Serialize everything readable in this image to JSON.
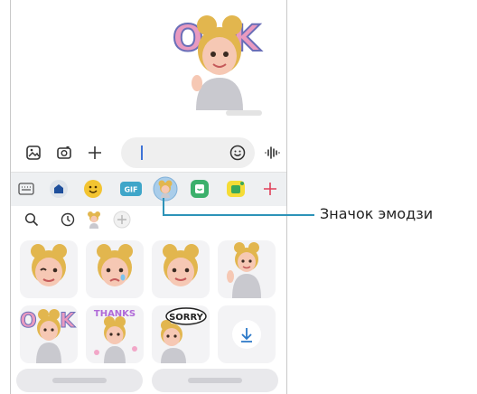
{
  "input_bar": {
    "icons": [
      "gallery-icon",
      "camera-icon",
      "plus-icon",
      "emoji-icon",
      "voice-icon"
    ]
  },
  "keyboard_tabs": {
    "items": [
      "keyboard",
      "home",
      "emoji",
      "gif",
      "ar-emoji",
      "sticker",
      "bitmoji",
      "plus"
    ],
    "gif_label": "GIF"
  },
  "sticker_sub_row": {
    "icons": [
      "search-icon",
      "recent-icon",
      "avatar-pack-icon",
      "add-icon"
    ]
  },
  "stickers": {
    "sorry_label": "SORRY",
    "thanks_label": "THANKS"
  },
  "colors": {
    "accent": "#2d93b8",
    "hair": "#e2b64e",
    "skin": "#f6c8b4",
    "hoodie": "#c9c9cf",
    "tab_bg": "#eef0f2"
  },
  "callout": {
    "label": "Значок эмодзи"
  }
}
